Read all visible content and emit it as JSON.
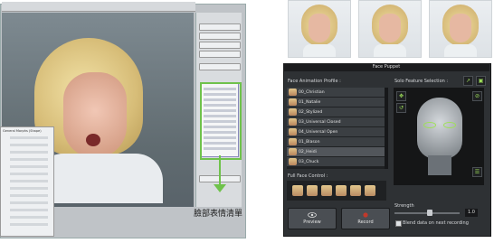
{
  "left_window": {
    "annotation_caption": "臉部表情清單",
    "morph_panel_title": "General Morphs (Shape)",
    "accent_color": "#6fc24b"
  },
  "thumbnails": [
    {
      "name": "pose-thumbnail-1"
    },
    {
      "name": "pose-thumbnail-2"
    },
    {
      "name": "pose-thumbnail-3"
    }
  ],
  "face_puppet": {
    "title": "Face Puppet",
    "profile_label": "Face Animation Profile :",
    "feature_label": "Solo Feature Selection :",
    "profiles": [
      {
        "label": "00_Christian"
      },
      {
        "label": "01_Natalie"
      },
      {
        "label": "02_Stylized"
      },
      {
        "label": "03_Universal Closed"
      },
      {
        "label": "04_Universal Open"
      },
      {
        "label": "01_Blason"
      },
      {
        "label": "02_Heidi"
      },
      {
        "label": "03_Chuck"
      },
      {
        "label": "04_Gwynn"
      }
    ],
    "selected_profile_index": 6,
    "full_face_label": "Full Face Control :",
    "preview_label": "Preview",
    "record_label": "Record",
    "strength_label": "Strength",
    "strength_value": "1.0",
    "blend_label": "Blend data on next recording",
    "record_color": "#c0392b",
    "feature_highlight_color": "#9fe05a"
  }
}
